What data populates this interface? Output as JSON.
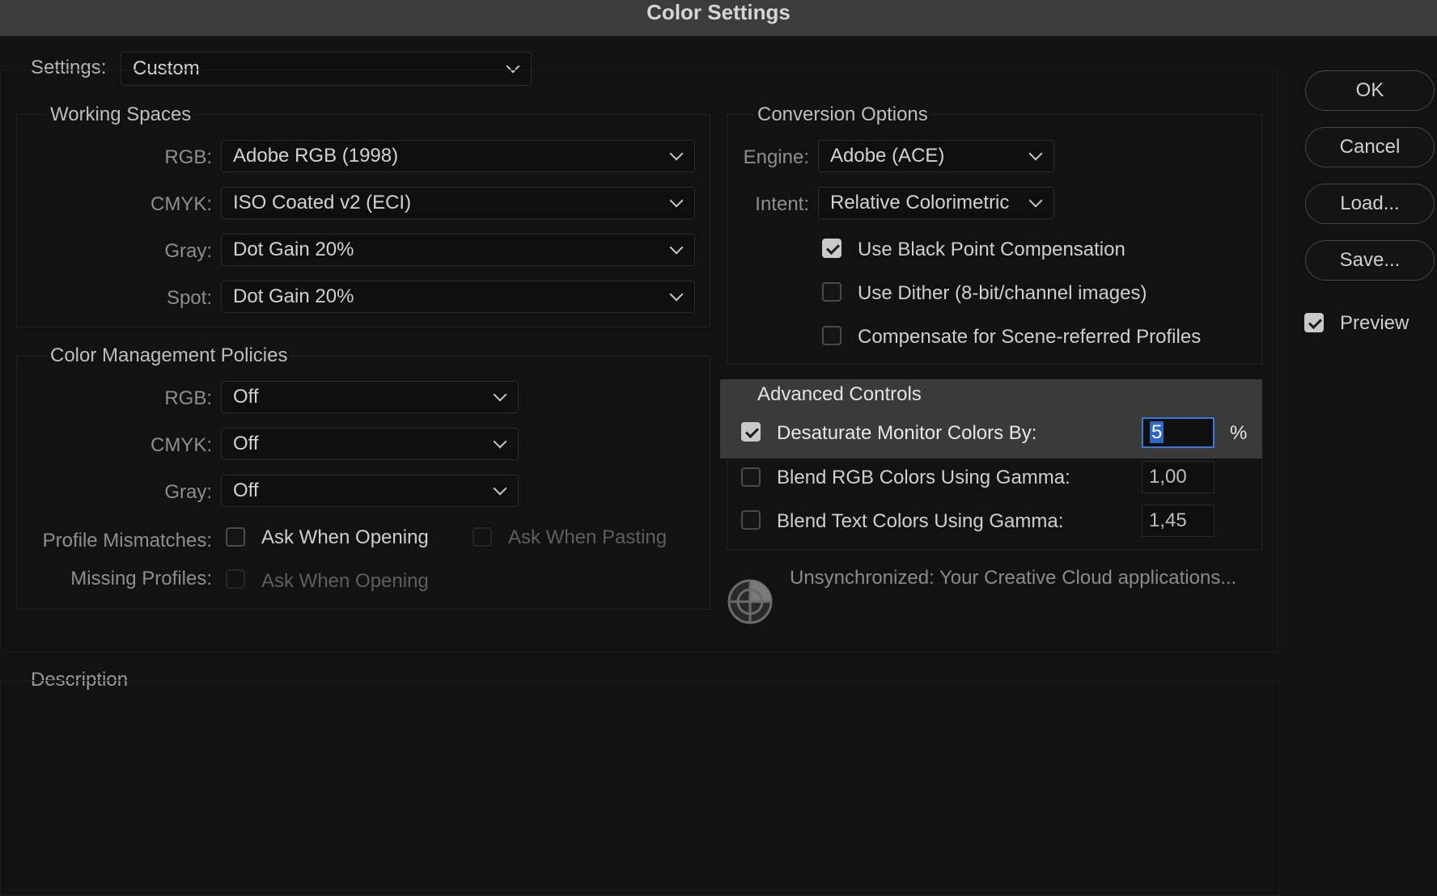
{
  "window": {
    "title": "Color Settings"
  },
  "settings": {
    "label": "Settings:",
    "value": "Custom"
  },
  "working_spaces": {
    "title": "Working Spaces",
    "rows": [
      {
        "label": "RGB:",
        "value": "Adobe RGB (1998)"
      },
      {
        "label": "CMYK:",
        "value": "ISO Coated v2 (ECI)"
      },
      {
        "label": "Gray:",
        "value": "Dot Gain 20%"
      },
      {
        "label": "Spot:",
        "value": "Dot Gain 20%"
      }
    ]
  },
  "policies": {
    "title": "Color Management Policies",
    "rows": [
      {
        "label": "RGB:",
        "value": "Off"
      },
      {
        "label": "CMYK:",
        "value": "Off"
      },
      {
        "label": "Gray:",
        "value": "Off"
      }
    ],
    "profile_mismatches": {
      "label": "Profile Mismatches:",
      "ask_when_opening": {
        "label": "Ask When Opening",
        "checked": false,
        "enabled": true
      },
      "ask_when_pasting": {
        "label": "Ask When Pasting",
        "checked": false,
        "enabled": false
      }
    },
    "missing_profiles": {
      "label": "Missing Profiles:",
      "ask_when_opening": {
        "label": "Ask When Opening",
        "checked": false,
        "enabled": false
      }
    }
  },
  "conversion": {
    "title": "Conversion Options",
    "engine": {
      "label": "Engine:",
      "value": "Adobe (ACE)"
    },
    "intent": {
      "label": "Intent:",
      "value": "Relative Colorimetric"
    },
    "options": [
      {
        "label": "Use Black Point Compensation",
        "checked": true
      },
      {
        "label": "Use Dither (8-bit/channel images)",
        "checked": false
      },
      {
        "label": "Compensate for Scene-referred Profiles",
        "checked": false
      }
    ]
  },
  "advanced": {
    "title": "Advanced Controls",
    "desaturate": {
      "label": "Desaturate Monitor Colors By:",
      "checked": true,
      "value": "5",
      "unit": "%"
    },
    "blend_rgb": {
      "label": "Blend RGB Colors Using Gamma:",
      "checked": false,
      "value": "1,00"
    },
    "blend_text": {
      "label": "Blend Text Colors Using Gamma:",
      "checked": false,
      "value": "1,45"
    }
  },
  "sync": {
    "text": "Unsynchronized: Your Creative Cloud applications...",
    "icon": "sync-status-icon"
  },
  "description": {
    "title": "Description"
  },
  "buttons": {
    "ok": "OK",
    "cancel": "Cancel",
    "load": "Load...",
    "save": "Save..."
  },
  "preview": {
    "label": "Preview",
    "checked": true
  },
  "colors": {
    "background": "#121212",
    "titlebar": "#3c3c3c",
    "highlight": "#3a3a3a",
    "focus": "#3a78d8"
  }
}
